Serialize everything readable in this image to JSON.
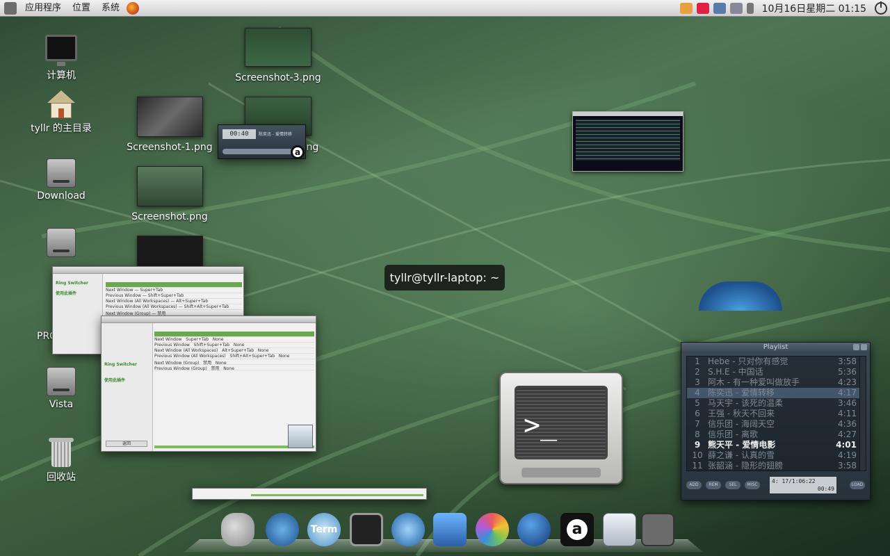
{
  "top_panel": {
    "menus": [
      "应用程序",
      "位置",
      "系统"
    ],
    "clock": "10月16日星期二 01:15",
    "icons": [
      "ubuntu-foot-icon",
      "firefox-icon"
    ],
    "tray_icons": [
      "key-icon",
      "chat-icon",
      "network-icon",
      "display-icon",
      "volume-icon",
      "power-icon"
    ]
  },
  "desktop_icons": [
    {
      "label": "计算机",
      "icon": "computer-icon"
    },
    {
      "label": "tyllr 的主目录",
      "icon": "home-folder-icon"
    },
    {
      "label": "Download",
      "icon": "drive-icon"
    },
    {
      "label": "PRO",
      "icon": "drive-icon"
    },
    {
      "label": "Vista",
      "icon": "drive-icon"
    },
    {
      "label": "回收站",
      "icon": "trash-icon"
    }
  ],
  "files": [
    {
      "label": "Screenshot-3.png"
    },
    {
      "label": "Screenshot-1.png"
    },
    {
      "label": "png"
    },
    {
      "label": "Screenshot.png"
    }
  ],
  "tooltip": "tyllr@tyllr-laptop: ~",
  "settings_window": {
    "sidebar": [
      "Ring Switcher",
      "使用此插件"
    ],
    "rows": [
      {
        "name": "Next Window",
        "key": "Super+Tab"
      },
      {
        "name": "Previous Window",
        "key": "Shift+Super+Tab"
      },
      {
        "name": "Next Window (All Workspaces)",
        "key": "Alt+Super+Tab"
      },
      {
        "name": "Previous Window (All Workspaces)",
        "key": "Shift+Alt+Super+Tab"
      },
      {
        "name": "Next Window (Group)",
        "key": "禁用"
      },
      {
        "name": "Previous Window (Group)",
        "key": "禁用"
      }
    ],
    "none_label": "None",
    "back_label": "返回"
  },
  "playlist": {
    "title": "Playlist",
    "tracks": [
      {
        "n": "1",
        "title": "Hebe - 只对你有感觉",
        "dur": "3:58"
      },
      {
        "n": "2",
        "title": "S.H.E - 中国话",
        "dur": "5:36"
      },
      {
        "n": "3",
        "title": "阿木 - 有一种爱叫做放手",
        "dur": "4:23"
      },
      {
        "n": "4",
        "title": "陈奕迅 - 爱情转移",
        "dur": "4:17"
      },
      {
        "n": "5",
        "title": "马天宇 - 该死的温柔",
        "dur": "3:46"
      },
      {
        "n": "6",
        "title": "王强 - 秋天不回来",
        "dur": "4:11"
      },
      {
        "n": "7",
        "title": "信乐团 - 海阔天空",
        "dur": "4:36"
      },
      {
        "n": "8",
        "title": "信乐团 - 离歌",
        "dur": "4:27"
      },
      {
        "n": "9",
        "title": "熊天平 - 爱情电影",
        "dur": "4:01"
      },
      {
        "n": "10",
        "title": "薛之谦 - 认真的雪",
        "dur": "4:19"
      },
      {
        "n": "11",
        "title": "张韶涵 - 隐形的翅膀",
        "dur": "3:58"
      }
    ],
    "buttons": [
      "ADD",
      "REM",
      "SEL",
      "MISC"
    ],
    "load_label": "LOAD",
    "lcd_line1": "4: 17/1:06:22",
    "lcd_line2": "00:49"
  },
  "mini_player": {
    "time": "00:40",
    "title": "陈奕迅 - 爱情转移"
  },
  "dock": {
    "term_label": "Term",
    "a_label": "a"
  },
  "colors": {
    "accent_green": "#6aa74f",
    "panel": "#dcdcdc"
  }
}
